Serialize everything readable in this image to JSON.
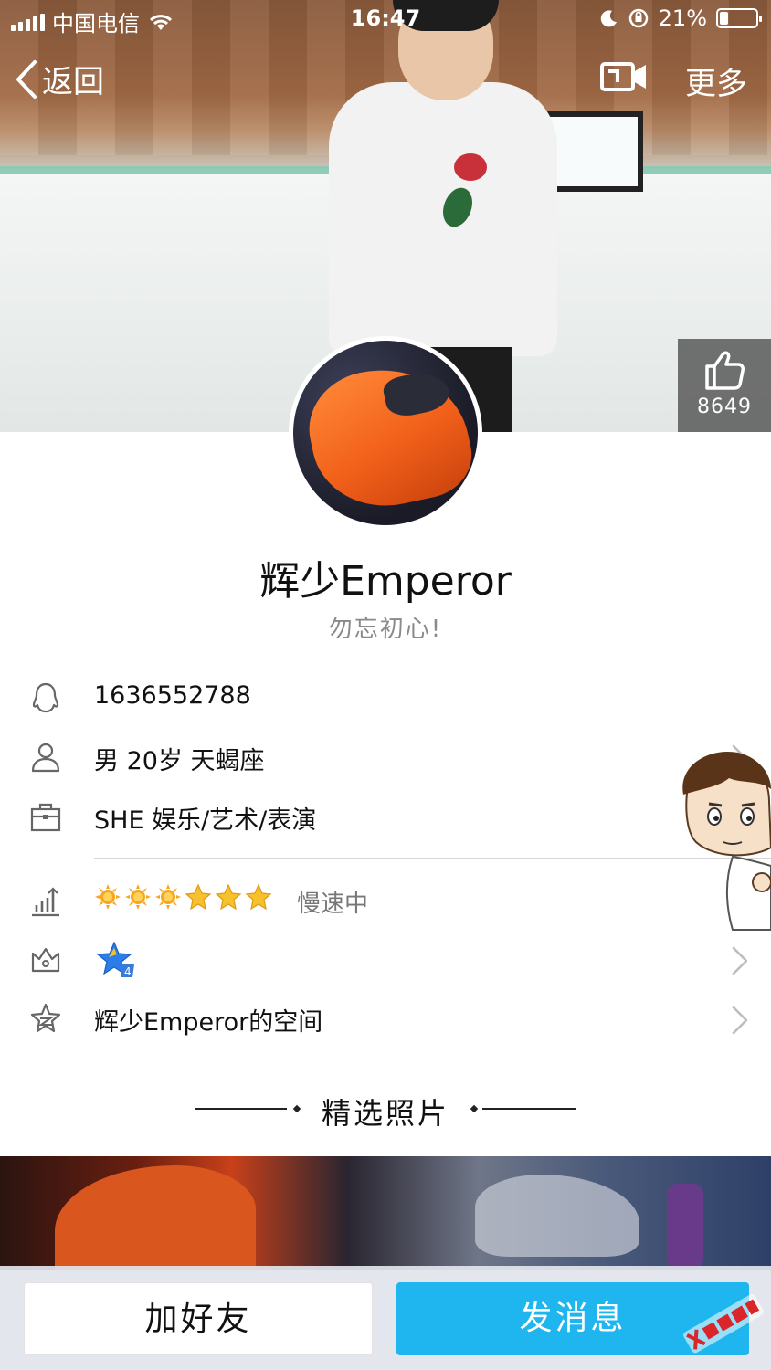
{
  "status_bar": {
    "carrier": "中国电信",
    "time": "16:47",
    "battery_text": "21%"
  },
  "nav": {
    "back_label": "返回",
    "more_label": "更多"
  },
  "like": {
    "count": "8649"
  },
  "profile": {
    "name": "辉少Emperor",
    "signature": "勿忘初心!"
  },
  "info": {
    "qq_number": "1636552788",
    "basic": "男 20岁 天蝎座",
    "occupation": "SHE 娱乐/艺术/表演",
    "level_status": "慢速中",
    "space": "辉少Emperor的空间"
  },
  "level": {
    "suns": 3,
    "stars": 3
  },
  "section": {
    "photos_title": "精选照片"
  },
  "actions": {
    "add_friend": "加好友",
    "send_message": "发消息"
  },
  "colors": {
    "accent": "#1fb5ee",
    "icon_gray": "#666666",
    "sun": "#f5a623",
    "star": "#f7c12d"
  }
}
